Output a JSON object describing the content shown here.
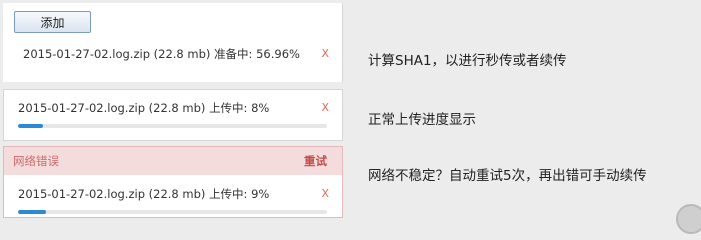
{
  "panel1": {
    "add_label": "添加",
    "file": {
      "name": "2015-01-27-02.log.zip",
      "size": "(22.8 mb)",
      "status": "准备中: 56.96%",
      "close": "X"
    }
  },
  "panel2": {
    "file": {
      "name": "2015-01-27-02.log.zip",
      "size": "(22.8 mb)",
      "status": "上传中: 8%",
      "close": "X",
      "progress": 0.08
    }
  },
  "panel3": {
    "error_text": "网络错误",
    "retry_label": "重试",
    "file": {
      "name": "2015-01-27-02.log.zip",
      "size": "(22.8 mb)",
      "status": "上传中: 9%",
      "close": "X",
      "progress": 0.09
    }
  },
  "notes": [
    "计算SHA1，以进行秒传或者续传",
    "正常上传进度显示",
    "网络不稳定？自动重试5次，再出错可手动续传"
  ],
  "colors": {
    "progress": "#2b8ad6",
    "error_bg": "#f5dcdc",
    "close": "#e06a55"
  }
}
